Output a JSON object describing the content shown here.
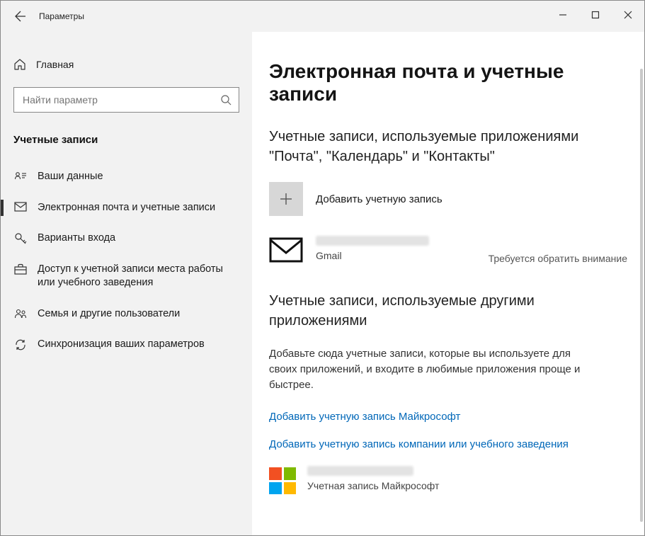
{
  "titlebar": {
    "title": "Параметры"
  },
  "sidebar": {
    "home": "Главная",
    "search_placeholder": "Найти параметр",
    "category": "Учетные записи",
    "items": [
      {
        "label": "Ваши данные"
      },
      {
        "label": "Электронная почта и учетные записи"
      },
      {
        "label": "Варианты входа"
      },
      {
        "label": "Доступ к учетной записи места работы или учебного заведения"
      },
      {
        "label": "Семья и другие пользователи"
      },
      {
        "label": "Синхронизация ваших параметров"
      }
    ]
  },
  "content": {
    "page_title": "Электронная почта и учетные записи",
    "section1_title": "Учетные записи, используемые приложениями \"Почта\", \"Календарь\" и \"Контакты\"",
    "add_account_label": "Добавить учетную запись",
    "gmail_account": {
      "type": "Gmail",
      "status": "Требуется обратить внимание"
    },
    "section2_title": "Учетные записи, используемые другими приложениями",
    "section2_desc": "Добавьте сюда учетные записи, которые вы используете для своих приложений, и входите в любимые приложения проще и быстрее.",
    "link_ms": "Добавить учетную запись Майкрософт",
    "link_work": "Добавить учетную запись компании или учебного заведения",
    "ms_account": {
      "type": "Учетная запись Майкрософт"
    }
  }
}
